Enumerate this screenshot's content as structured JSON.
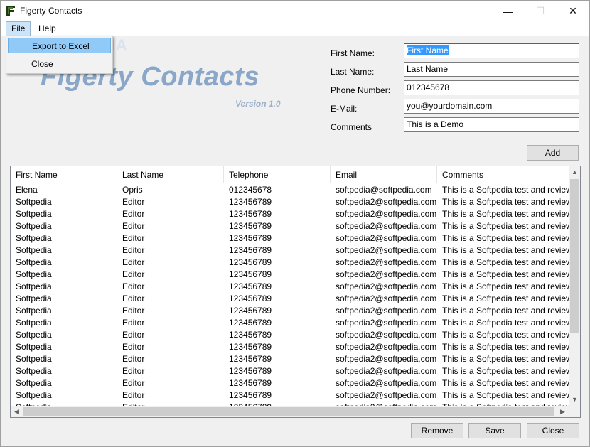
{
  "window": {
    "title": "Figerty Contacts",
    "controls": {
      "minimize": "—",
      "maximize": "☐",
      "close": "✕"
    }
  },
  "menu": {
    "file": "File",
    "help": "Help",
    "file_items": [
      "Export to Excel",
      "Close"
    ]
  },
  "logo": {
    "title": "Figerty Contacts",
    "version": "Version 1.0",
    "watermark": "SOFTPEDIA"
  },
  "form": {
    "first_name": {
      "label": "First Name:",
      "value": "First Name"
    },
    "last_name": {
      "label": "Last Name:",
      "value": "Last Name"
    },
    "phone": {
      "label": "Phone Number:",
      "value": "012345678"
    },
    "email": {
      "label": "E-Mail:",
      "value": "you@yourdomain.com"
    },
    "comments": {
      "label": "Comments",
      "value": "This is a Demo"
    },
    "add_label": "Add"
  },
  "table": {
    "columns": [
      "First Name",
      "Last Name",
      "Telephone",
      "Email",
      "Comments"
    ],
    "rows": [
      [
        "Elena",
        "Opris",
        "012345678",
        "softpedia@softpedia.com",
        "This is a Softpedia test and review"
      ],
      [
        "Softpedia",
        "Editor",
        "123456789",
        "softpedia2@softpedia.com",
        "This is a Softpedia test and review"
      ],
      [
        "Softpedia",
        "Editor",
        "123456789",
        "softpedia2@softpedia.com",
        "This is a Softpedia test and review"
      ],
      [
        "Softpedia",
        "Editor",
        "123456789",
        "softpedia2@softpedia.com",
        "This is a Softpedia test and review"
      ],
      [
        "Softpedia",
        "Editor",
        "123456789",
        "softpedia2@softpedia.com",
        "This is a Softpedia test and review"
      ],
      [
        "Softpedia",
        "Editor",
        "123456789",
        "softpedia2@softpedia.com",
        "This is a Softpedia test and review"
      ],
      [
        "Softpedia",
        "Editor",
        "123456789",
        "softpedia2@softpedia.com",
        "This is a Softpedia test and review"
      ],
      [
        "Softpedia",
        "Editor",
        "123456789",
        "softpedia2@softpedia.com",
        "This is a Softpedia test and review"
      ],
      [
        "Softpedia",
        "Editor",
        "123456789",
        "softpedia2@softpedia.com",
        "This is a Softpedia test and review"
      ],
      [
        "Softpedia",
        "Editor",
        "123456789",
        "softpedia2@softpedia.com",
        "This is a Softpedia test and review"
      ],
      [
        "Softpedia",
        "Editor",
        "123456789",
        "softpedia2@softpedia.com",
        "This is a Softpedia test and review"
      ],
      [
        "Softpedia",
        "Editor",
        "123456789",
        "softpedia2@softpedia.com",
        "This is a Softpedia test and review"
      ],
      [
        "Softpedia",
        "Editor",
        "123456789",
        "softpedia2@softpedia.com",
        "This is a Softpedia test and review"
      ],
      [
        "Softpedia",
        "Editor",
        "123456789",
        "softpedia2@softpedia.com",
        "This is a Softpedia test and review"
      ],
      [
        "Softpedia",
        "Editor",
        "123456789",
        "softpedia2@softpedia.com",
        "This is a Softpedia test and review"
      ],
      [
        "Softpedia",
        "Editor",
        "123456789",
        "softpedia2@softpedia.com",
        "This is a Softpedia test and review"
      ],
      [
        "Softpedia",
        "Editor",
        "123456789",
        "softpedia2@softpedia.com",
        "This is a Softpedia test and review"
      ],
      [
        "Softpedia",
        "Editor",
        "123456789",
        "softpedia2@softpedia.com",
        "This is a Softpedia test and review"
      ],
      [
        "Softpedia",
        "Editor",
        "123456789",
        "softpedia2@softpedia.com",
        "This is a Softpedia test and review"
      ]
    ]
  },
  "scroll": {
    "up": "▲",
    "down": "▼",
    "left": "◀",
    "right": "▶"
  },
  "buttons": {
    "remove": "Remove",
    "save": "Save",
    "close": "Close"
  },
  "colors": {
    "logo": "#8aa6c8",
    "selection": "#3399ff",
    "menu_highlight": "#91c9f7"
  }
}
